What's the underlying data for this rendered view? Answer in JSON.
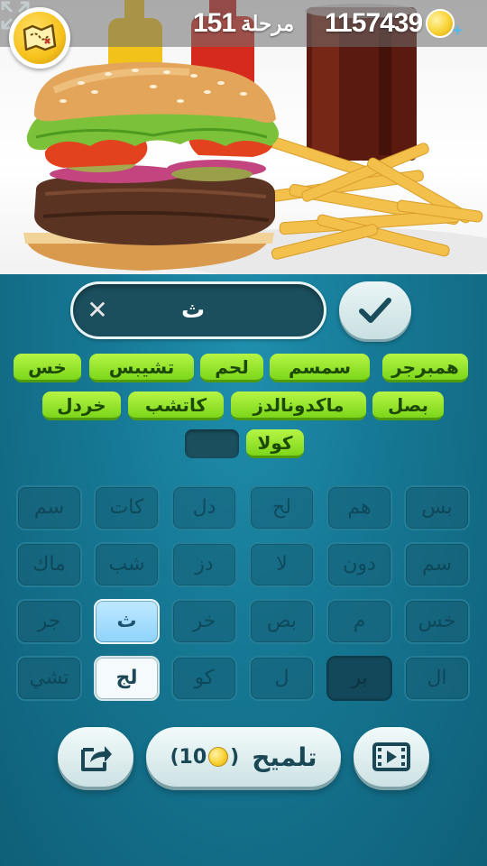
{
  "header": {
    "level_label": "مرحلة",
    "level_number": "151",
    "coins": "1157439",
    "map_icon": "treasure-map-icon",
    "coin_icon": "coin-icon",
    "add_icon": "plus-icon"
  },
  "photo": {
    "subject": "burger-and-fries-photo",
    "expand_icon": "expand-icon"
  },
  "answer": {
    "current": "ث",
    "clear_icon": "close-icon",
    "submit_icon": "check-icon"
  },
  "found_words": {
    "row1": [
      "همبرجر",
      "سمسم",
      "لحم",
      "تشيبس",
      "خس"
    ],
    "row2": [
      "بصل",
      "ماكدونالدز",
      "كاتشب",
      "خردل"
    ],
    "row3": [
      "كولا"
    ]
  },
  "tiles": {
    "row1": [
      "بس",
      "هم",
      "لح",
      "دل",
      "كات",
      "سم"
    ],
    "row2": [
      "سم",
      "دون",
      "لا",
      "دز",
      "شب",
      "ماك"
    ],
    "row3": [
      "خس",
      "م",
      "بص",
      "خر",
      "ث",
      "جر"
    ],
    "row4": [
      "ال",
      "بر",
      "ل",
      "كو",
      "لج",
      "تشي"
    ]
  },
  "footer": {
    "hint_label": "تلميح",
    "hint_cost": "10",
    "share_icon": "share-icon",
    "video_icon": "video-reward-icon"
  },
  "colors": {
    "background": "#167995",
    "word_green": "#7cd61a",
    "tile_active": "#8fd3fb",
    "coin_gold": "#f8d233"
  }
}
